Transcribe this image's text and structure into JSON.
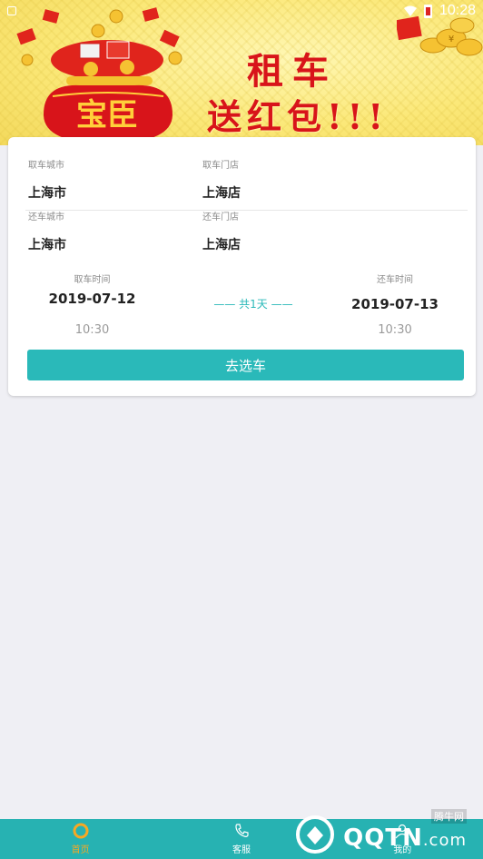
{
  "status_bar": {
    "time": "10:28"
  },
  "banner": {
    "bag_text": "宝臣",
    "title_line1": "租车",
    "title_line2": "送红包!!!",
    "coin_symbol": "¥"
  },
  "booking": {
    "pickup_city_label": "取车城市",
    "pickup_city_value": "上海市",
    "pickup_store_label": "取车门店",
    "pickup_store_value": "上海店",
    "return_city_label": "还车城市",
    "return_city_value": "上海市",
    "return_store_label": "还车门店",
    "return_store_value": "上海店",
    "pickup_time_label": "取车时间",
    "pickup_date": "2019-07-12",
    "pickup_hour": "10:30",
    "duration": "—— 共1天 ——",
    "return_time_label": "还车时间",
    "return_date": "2019-07-13",
    "return_hour": "10:30",
    "submit_label": "去选车"
  },
  "nav": {
    "items": [
      {
        "label": "首页",
        "icon": "home-icon"
      },
      {
        "label": "客服",
        "icon": "phone-icon"
      },
      {
        "label": "我的",
        "icon": "user-icon"
      }
    ]
  },
  "watermark": {
    "site": "腾牛网",
    "text": "QQTN",
    "suffix": ".com"
  },
  "colors": {
    "accent": "#2ab9b9",
    "nav_bg": "#27b2b2",
    "banner_red": "#d8141a",
    "active": "#f7a823"
  }
}
